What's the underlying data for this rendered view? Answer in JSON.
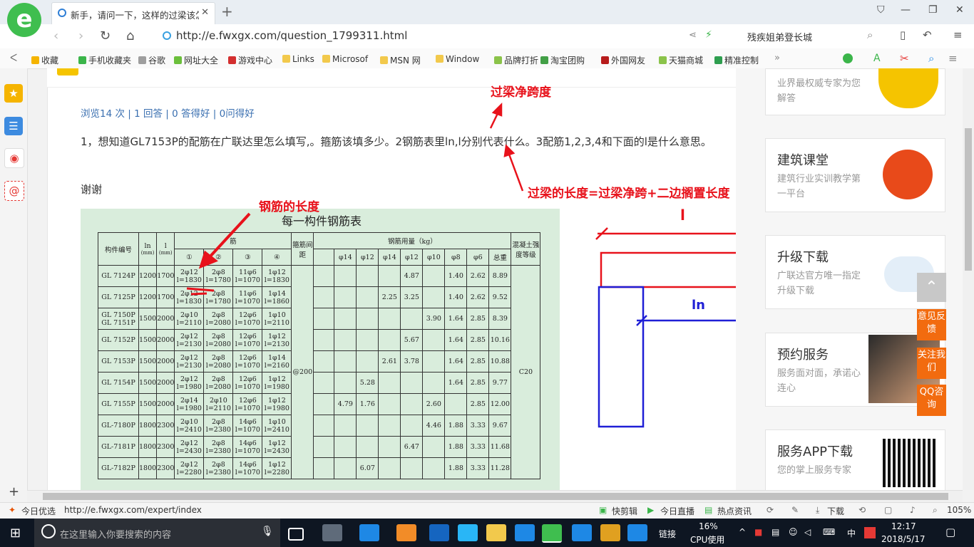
{
  "browser": {
    "tab_title": "新手，请问一下，这样的过梁该怎么",
    "tab_close": "✕",
    "new_tab": "+",
    "url": "http://e.fwxgx.com/question_1799311.html",
    "search_text": "残疾姐弟登长城"
  },
  "bookmarks": [
    {
      "label": "收藏",
      "color": "#f5b400"
    },
    {
      "label": "手机收藏夹",
      "color": "#3bb54a"
    },
    {
      "label": "谷歌",
      "color": "#9e9e9e"
    },
    {
      "label": "网址大全",
      "color": "#6bbf3b"
    },
    {
      "label": "游戏中心",
      "color": "#d32f2f"
    },
    {
      "label": "Links",
      "color": "#f2c94c"
    },
    {
      "label": "Microsof",
      "color": "#f2c94c"
    },
    {
      "label": "MSN 网",
      "color": "#f2c94c"
    },
    {
      "label": "Window",
      "color": "#f2c94c"
    },
    {
      "label": "品牌打折",
      "color": "#8bc34a"
    },
    {
      "label": "淘宝团购",
      "color": "#43a047"
    },
    {
      "label": "外国网友",
      "color": "#b71c1c"
    },
    {
      "label": "天猫商城",
      "color": "#8bc34a"
    },
    {
      "label": "精准控制",
      "color": "#2e9e4f"
    }
  ],
  "question": {
    "stats": "浏览14 次 | 1 回答 | 0 答得好 | 0问得好",
    "body": "1，想知道GL7153P的配筋在广联达里怎么填写,。箍筋该填多少。2钢筋表里ln,l分别代表什么。3配筋1,2,3,4和下面的l是什么意思。",
    "thanks": "谢谢"
  },
  "annotations": {
    "net_span": "过梁净跨度",
    "total_length": "过梁的长度=过梁净跨+二边搁置长度",
    "rebar_length": "钢筋的长度",
    "dim_l": "l",
    "dim_ln": "ln",
    "colors": {
      "red": "#e8121b",
      "blue": "#1f1fd6"
    }
  },
  "rebar_table": {
    "title": "每一构件钢筋表",
    "headers": {
      "member_no": "构件编号",
      "ln": "ln",
      "ln_unit": "(mm)",
      "l": "l",
      "l_unit": "(mm)",
      "rebar": "筋",
      "bar_nums": [
        "①",
        "②",
        "③",
        "④"
      ],
      "stirrup_spacing": "箍筋间距",
      "usage": "钢筋用量（kg）",
      "usage_cols": [
        "φ14",
        "φ12",
        "φ14",
        "φ12",
        "φ10",
        "φ8",
        "φ6",
        "总重"
      ],
      "concrete": "混凝土强度等级"
    },
    "rows": [
      {
        "id": "GL 7124P",
        "ln": "1200",
        "l": "1700",
        "b1": "2φ12 l=1830",
        "b2": "2φ8 l=1780",
        "b3": "11φ6 l=1070",
        "b4": "1φ12 l=1830",
        "u": [
          "",
          "",
          "",
          "4.87",
          "",
          "1.40",
          "2.62",
          "8.89"
        ]
      },
      {
        "id": "GL 7125P",
        "ln": "1200",
        "l": "1700",
        "b1": "2φ12 l=1830",
        "b2": "2φ8 l=1780",
        "b3": "11φ6 l=1070",
        "b4": "1φ14 l=1860",
        "u": [
          "",
          "",
          "2.25",
          "3.25",
          "",
          "1.40",
          "2.62",
          "9.52"
        ]
      },
      {
        "id": "GL 7150P GL 7151P",
        "ln": "1500",
        "l": "2000",
        "b1": "2φ10 l=2110",
        "b2": "2φ8 l=2080",
        "b3": "12φ6 l=1070",
        "b4": "1φ10 l=2110",
        "u": [
          "",
          "",
          "",
          "",
          "3.90",
          "1.64",
          "2.85",
          "8.39"
        ]
      },
      {
        "id": "GL 7152P",
        "ln": "1500",
        "l": "2000",
        "b1": "2φ12 l=2130",
        "b2": "2φ8 l=2080",
        "b3": "12φ6 l=1070",
        "b4": "1φ12 l=2130",
        "u": [
          "",
          "",
          "",
          "5.67",
          "",
          "1.64",
          "2.85",
          "10.16"
        ]
      },
      {
        "id": "GL 7153P",
        "ln": "1500",
        "l": "2000",
        "b1": "2φ12 l=2130",
        "b2": "2φ8 l=2080",
        "b3": "12φ6 l=1070",
        "b4": "1φ14 l=2160",
        "u": [
          "",
          "",
          "2.61",
          "3.78",
          "",
          "1.64",
          "2.85",
          "10.88"
        ]
      },
      {
        "id": "GL 7154P",
        "ln": "1500",
        "l": "2000",
        "b1": "2φ12 l=1980",
        "b2": "2φ8 l=2080",
        "b3": "12φ6 l=1070",
        "b4": "1φ12 l=1980",
        "u": [
          "",
          "5.28",
          "",
          "",
          "",
          "1.64",
          "2.85",
          "9.77"
        ]
      },
      {
        "id": "GL 7155P",
        "ln": "1500",
        "l": "2000",
        "b1": "2φ14 l=1980",
        "b2": "2φ10 l=2110",
        "b3": "12φ6 l=1070",
        "b4": "1φ12 l=1980",
        "u": [
          "4.79",
          "1.76",
          "",
          "",
          "2.60",
          "",
          "2.85",
          "12.00"
        ]
      },
      {
        "id": "GL-7180P",
        "ln": "1800",
        "l": "2300",
        "b1": "2φ10 l=2410",
        "b2": "2φ8 l=2380",
        "b3": "14φ6 l=1070",
        "b4": "1φ10 l=2410",
        "u": [
          "",
          "",
          "",
          "",
          "4.46",
          "1.88",
          "3.33",
          "9.67"
        ]
      },
      {
        "id": "GL-7181P",
        "ln": "1800",
        "l": "2300",
        "b1": "2φ12 l=2430",
        "b2": "2φ8 l=2380",
        "b3": "14φ6 l=1070",
        "b4": "1φ12 l=2430",
        "u": [
          "",
          "",
          "",
          "6.47",
          "",
          "1.88",
          "3.33",
          "11.68"
        ]
      },
      {
        "id": "GL-7182P",
        "ln": "1800",
        "l": "2300",
        "b1": "2φ12 l=2280",
        "b2": "2φ8 l=2380",
        "b3": "14φ6 l=1070",
        "b4": "1φ12 l=2280",
        "u": [
          "",
          "6.07",
          "",
          "",
          "",
          "1.88",
          "3.33",
          "11.28"
        ]
      }
    ],
    "spacing_value": "@200",
    "concrete_grade": "C20"
  },
  "sidebar": {
    "cards": [
      {
        "title": "",
        "desc": "业界最权威专家为您解答"
      },
      {
        "title": "建筑课堂",
        "desc": "建筑行业实训教学第一平台"
      },
      {
        "title": "升级下载",
        "desc": "广联达官方唯一指定升级下载"
      },
      {
        "title": "预约服务",
        "desc": "服务面对面，承诺心连心"
      },
      {
        "title": "服务APP下载",
        "desc": "您的掌上服务专家"
      }
    ],
    "float_buttons": [
      "意见反馈",
      "关注我们",
      "QQ咨询"
    ]
  },
  "statusbar": {
    "left": "今日优选",
    "url": "http://e.fwxgx.com/expert/index",
    "items": [
      "快剪辑",
      "今日直播",
      "热点资讯",
      "下载"
    ],
    "zoom": "105%"
  },
  "taskbar": {
    "search_placeholder": "在这里输入你要搜索的内容",
    "link_label": "链接",
    "cpu_percent": "16%",
    "cpu_label": "CPU使用",
    "ime": "中",
    "time": "12:17",
    "date": "2018/5/17"
  }
}
